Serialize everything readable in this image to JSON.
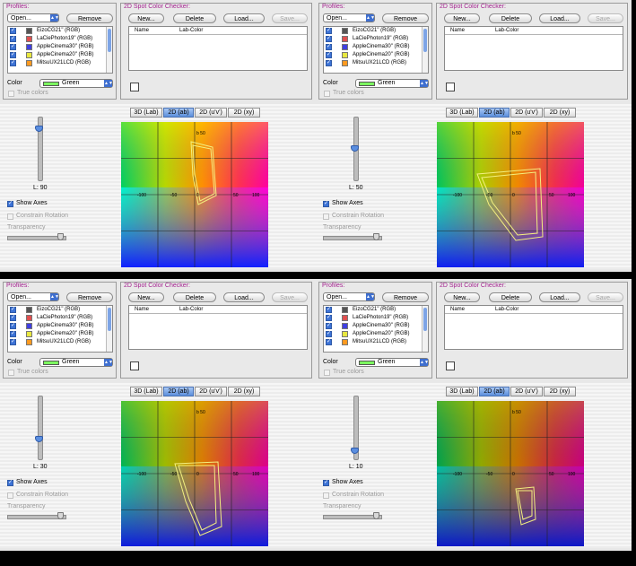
{
  "profiles_panel": {
    "title": "Profiles:",
    "open_label": "Open...",
    "remove_label": "Remove",
    "color_label": "Color",
    "color_value": "Green",
    "color_swatch": "#7cfc60",
    "true_colors_label": "True colors"
  },
  "spot_panel": {
    "title": "2D Spot Color Checker:",
    "new_label": "New...",
    "delete_label": "Delete",
    "load_label": "Load...",
    "save_label": "Save...",
    "col_name": "Name",
    "col_lab": "Lab-Color"
  },
  "tabs": [
    "3D (Lab)",
    "2D (ab)",
    "2D (u'v')",
    "2D (xy)"
  ],
  "show_axes_label": "Show Axes",
  "constrain_label": "Constrain Rotation",
  "transparency_label": "Transparency",
  "axis_labels": {
    "top": "b 50",
    "left": "-100",
    "mid1": "-50",
    "mid2": "0",
    "a": "a",
    "mid3": "50",
    "right": "100"
  },
  "quadrants": [
    {
      "id": "q1",
      "lightness": "L: 90",
      "slider": 0.84,
      "profiles": [
        "EizoCG21\" (RGB)",
        "LaCiePhoton19\" (RGB)",
        "AppleCinema30\" (RGB)",
        "AppleCinema20\" (RGB)",
        "MitsuUX21LCD (RGB)"
      ]
    },
    {
      "id": "q2",
      "lightness": "L: 50",
      "slider": 0.5,
      "profiles": [
        "EizoCG21\" (RGB)",
        "LaCiePhoton19\" (RGB)",
        "AppleCinema30\" (RGB)",
        "AppleCinema20\" (RGB)",
        "MitsuUX21LCD (RGB)"
      ]
    },
    {
      "id": "q3",
      "lightness": "L: 30",
      "slider": 0.3,
      "profiles": [
        "EizoCG21\" (RGB)",
        "LaCiePhoton19\" (RGB)",
        "AppleCinema30\" (RGB)",
        "AppleCinema20\" (RGB)",
        "MitsuUX21LCD (RGB)"
      ]
    },
    {
      "id": "q4",
      "lightness": "L: 10",
      "slider": 0.1,
      "profiles": [
        "EizoCG21\" (RGB)",
        "LaCiePhoton19\" (RGB)",
        "AppleCinema30\" (RGB)",
        "AppleCinema20\" (RGB)",
        "MitsuUX21LCD (RGB)"
      ]
    }
  ],
  "profile_swatches": [
    "#555555",
    "#e05050",
    "#4040e0",
    "#e8e840",
    "#ff9a20"
  ],
  "selected_tab_index": 1
}
